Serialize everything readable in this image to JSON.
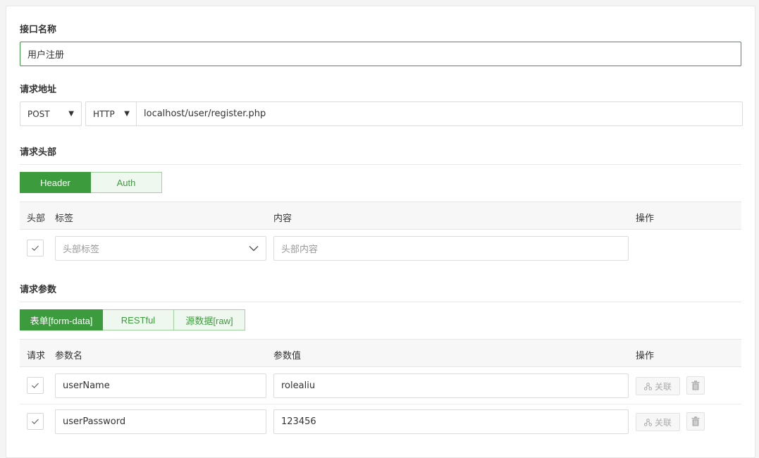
{
  "api_name": {
    "label": "接口名称",
    "value": "用户注册"
  },
  "request_url": {
    "label": "请求地址",
    "method": "POST",
    "protocol": "HTTP",
    "url": "localhost/user/register.php"
  },
  "request_header": {
    "label": "请求头部",
    "tabs": [
      "Header",
      "Auth"
    ],
    "active_tab": "Header",
    "columns": [
      "头部",
      "标签",
      "内容",
      "操作"
    ],
    "row": {
      "tag_placeholder": "头部标签",
      "content_placeholder": "头部内容",
      "checked": true
    }
  },
  "request_params": {
    "label": "请求参数",
    "tabs": [
      "表单[form-data]",
      "RESTful",
      "源数据[raw]"
    ],
    "active_tab": "表单[form-data]",
    "columns": [
      "请求",
      "参数名",
      "参数值",
      "操作"
    ],
    "rows": [
      {
        "name": "userName",
        "value": "rolealiu",
        "link_label": "关联",
        "checked": true
      },
      {
        "name": "userPassword",
        "value": "123456",
        "link_label": "关联",
        "checked": true
      }
    ]
  },
  "colors": {
    "accent": "#3c9b3c",
    "accent_light": "#eef8ee"
  }
}
